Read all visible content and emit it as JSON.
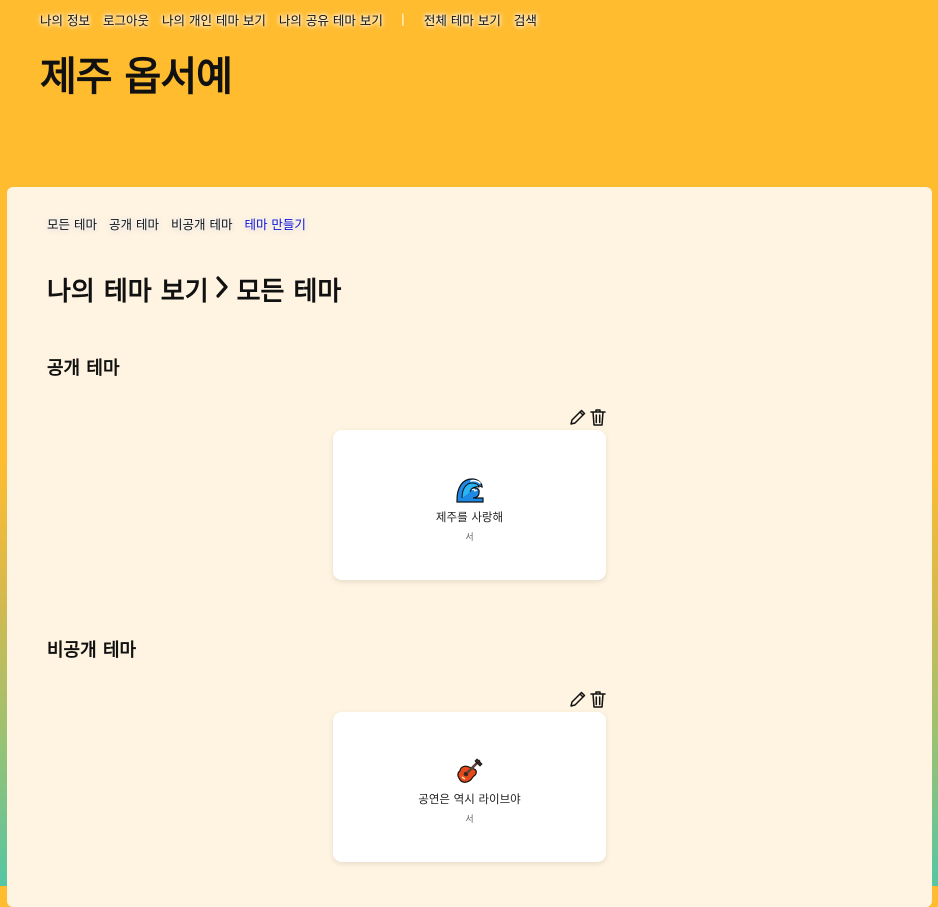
{
  "topnav": {
    "items": [
      "나의 정보",
      "로그아웃",
      "나의 개인 테마 보기",
      "나의 공유 테마 보기"
    ],
    "separator": "|",
    "items_right": [
      "전체 테마 보기",
      "검색"
    ]
  },
  "site_title": "제주 옵서예",
  "subnav": {
    "items": [
      "모든 테마",
      "공개 테마",
      "비공개 테마"
    ],
    "create_label": "테마 만들기"
  },
  "page_title": {
    "part1": "나의 테마 보기",
    "part2": "모든 테마"
  },
  "sections": [
    {
      "title": "공개 테마",
      "card": {
        "icon": "wave-icon",
        "name": "제주를 사랑해",
        "owner": "서"
      }
    },
    {
      "title": "비공개 테마",
      "card": {
        "icon": "guitar-icon",
        "name": "공연은 역시 라이브야",
        "owner": "서"
      }
    }
  ],
  "colors": {
    "header_bg": "#FFBC2F",
    "panel_bg": "#FFF4E1",
    "active_link": "#1010CC"
  }
}
